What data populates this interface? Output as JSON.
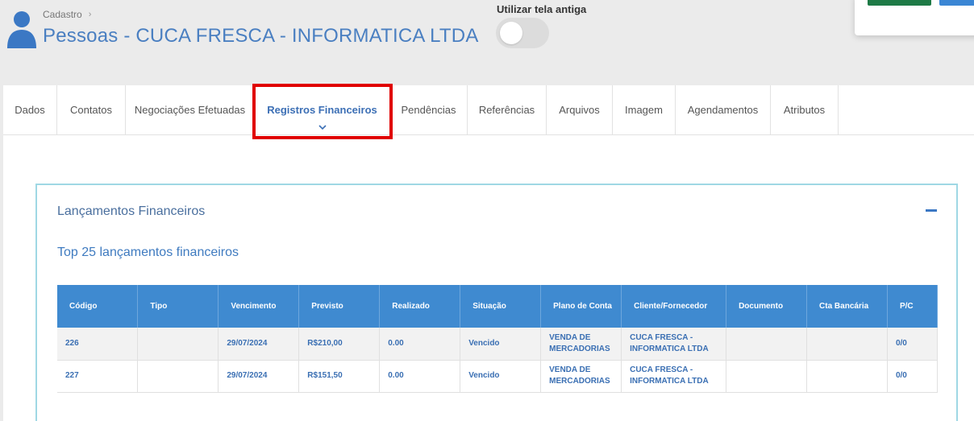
{
  "header": {
    "breadcrumb": "Cadastro",
    "title": "Pessoas - CUCA FRESCA - INFORMATICA LTDA",
    "toggle_label": "Utilizar tela antiga",
    "toggle_on": false
  },
  "tabs": [
    {
      "label": "Dados",
      "w": 67
    },
    {
      "label": "Contatos",
      "w": 85
    },
    {
      "label": "Negociações Efetuadas",
      "w": 160
    },
    {
      "label": "Registros Financeiros",
      "w": 168,
      "active": true
    },
    {
      "label": "Pendências",
      "w": 96
    },
    {
      "label": "Referências",
      "w": 98
    },
    {
      "label": "Arquivos",
      "w": 82
    },
    {
      "label": "Imagem",
      "w": 78
    },
    {
      "label": "Agendamentos",
      "w": 118
    },
    {
      "label": "Atributos",
      "w": 84
    }
  ],
  "panel": {
    "title": "Lançamentos Financeiros",
    "subtitle": "Top 25 lançamentos financeiros"
  },
  "table": {
    "headers": [
      "Código",
      "Tipo",
      "Vencimento",
      "Previsto",
      "Realizado",
      "Situação",
      "Plano de Conta",
      "Cliente/Fornecedor",
      "Documento",
      "Cta Bancária",
      "P/C"
    ],
    "rows": [
      [
        "226",
        "",
        "29/07/2024",
        "R$210,00",
        "0.00",
        "Vencido",
        "VENDA DE MERCADORIAS",
        "CUCA FRESCA - INFORMATICA LTDA",
        "",
        "",
        "0/0"
      ],
      [
        "227",
        "",
        "29/07/2024",
        "R$151,50",
        "0.00",
        "Vencido",
        "VENDA DE MERCADORIAS",
        "CUCA FRESCA - INFORMATICA LTDA",
        "",
        "",
        "0/0"
      ]
    ]
  },
  "colors": {
    "accent": "#3f8ad0",
    "title": "#4a7fc1",
    "highlight": "#e00000"
  }
}
